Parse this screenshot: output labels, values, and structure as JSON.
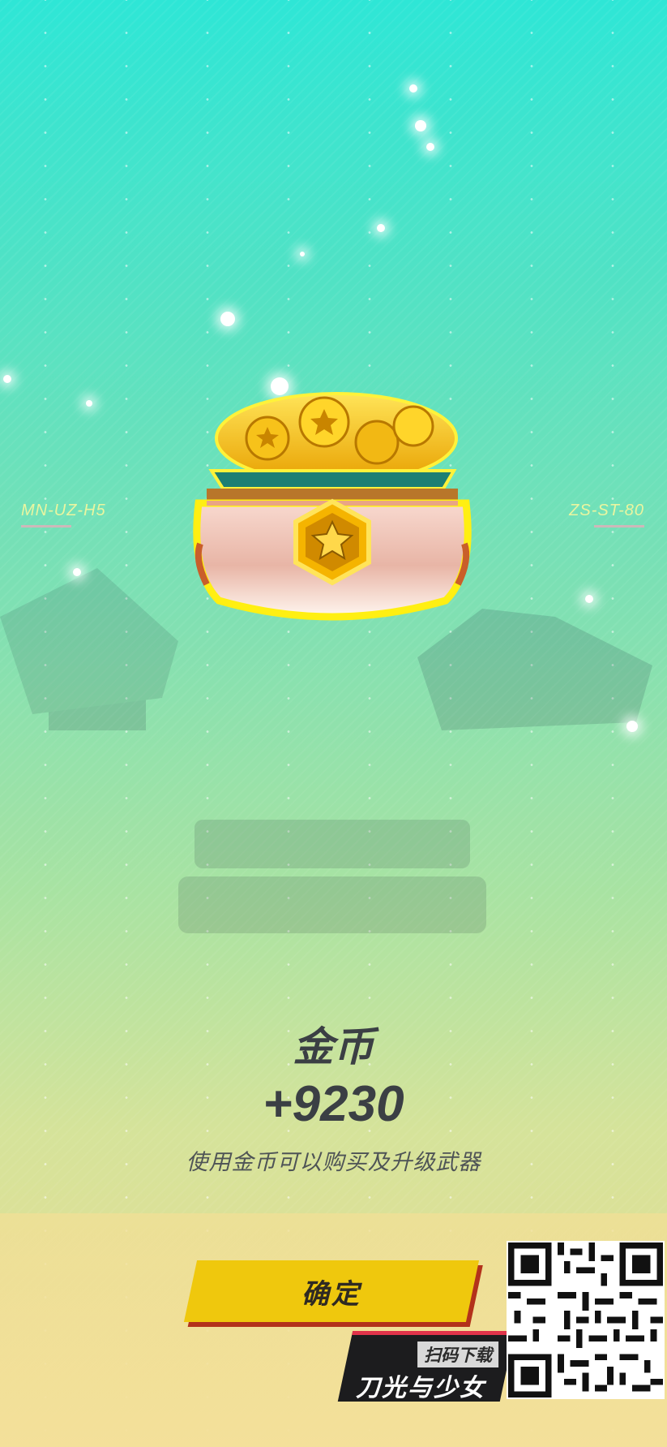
{
  "side_labels": {
    "left": "MN-UZ-H5",
    "right": "ZS-ST-80"
  },
  "reward": {
    "item_name": "金币",
    "amount": "+9230",
    "description": "使用金币可以购买及升级武器",
    "icon": "gold-coin-pot-icon"
  },
  "confirm_button": {
    "label": "确定"
  },
  "promo": {
    "scan_label": "扫码下载",
    "game_name": "刀光与少女",
    "qr_icon": "qr-code-icon"
  },
  "colors": {
    "accent_yellow": "#efc80d",
    "accent_red": "#b3321b",
    "text_dark": "#3b3f44"
  }
}
